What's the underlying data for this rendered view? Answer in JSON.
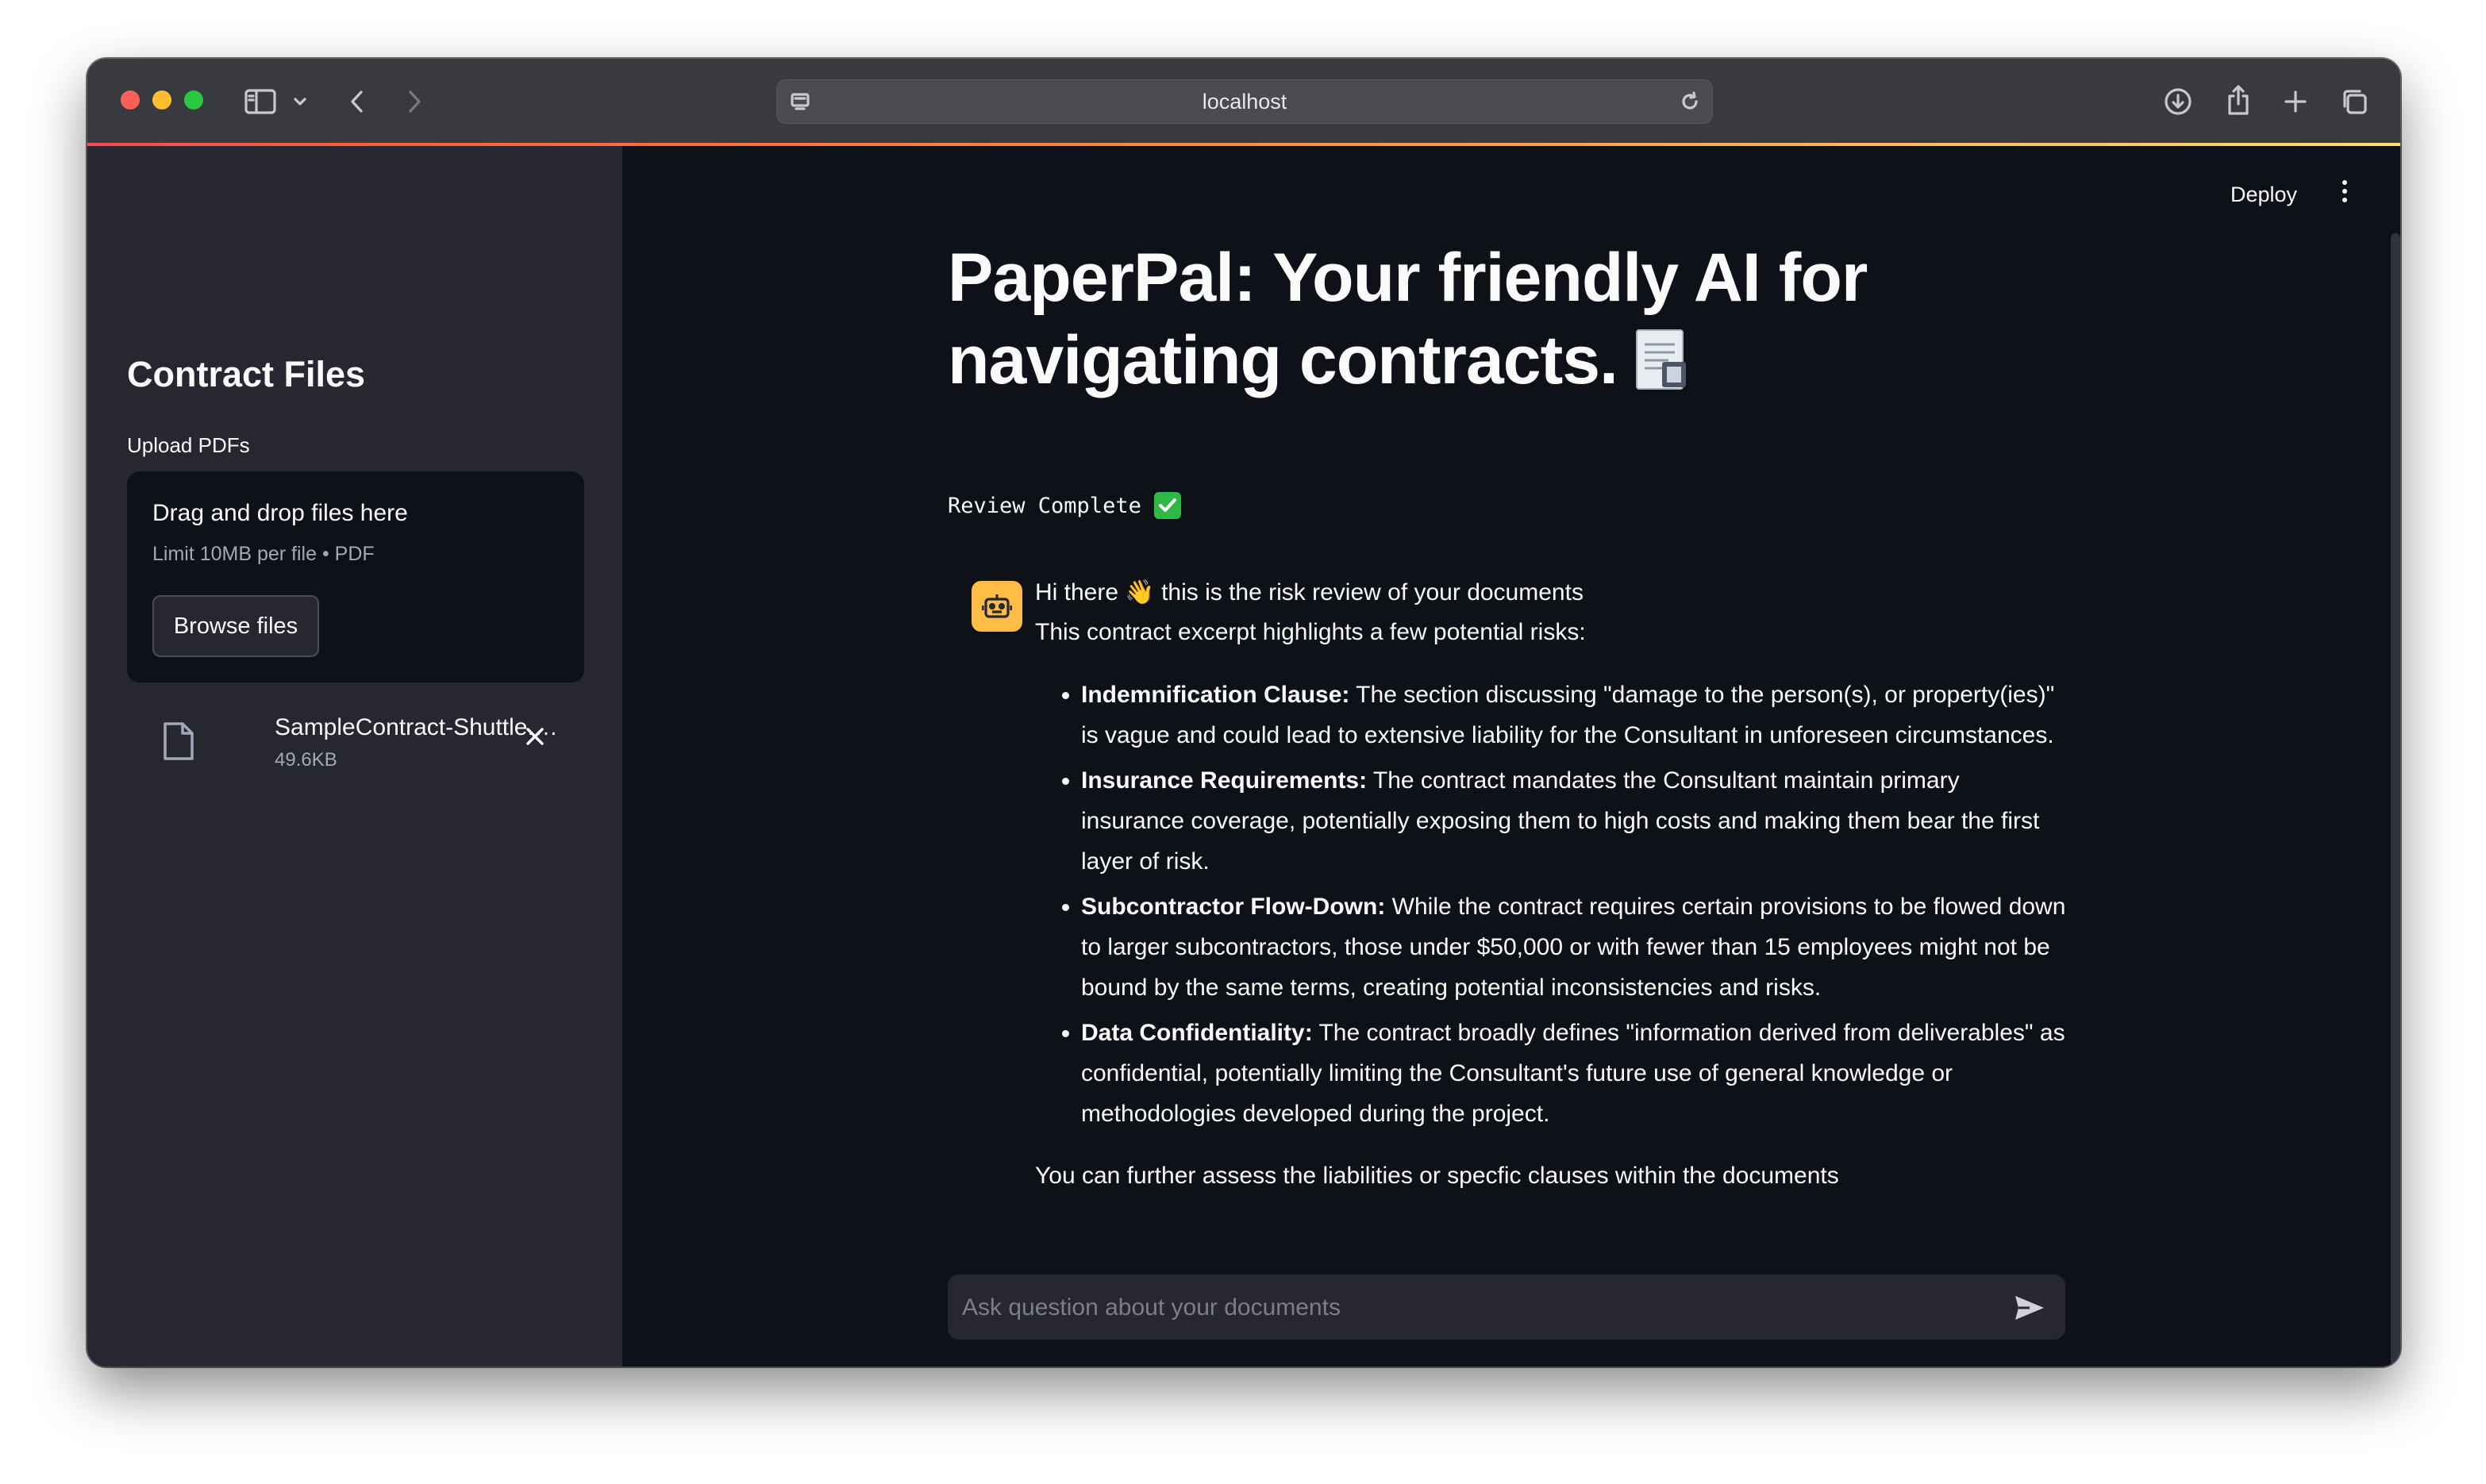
{
  "browser": {
    "url": "localhost"
  },
  "header": {
    "deploy_label": "Deploy"
  },
  "sidebar": {
    "title": "Contract Files",
    "upload_label": "Upload PDFs",
    "dropzone": {
      "title": "Drag and drop files here",
      "subtitle": "Limit 10MB per file • PDF",
      "browse_label": "Browse files"
    },
    "file": {
      "name": "SampleContract-Shuttle.…",
      "size": "49.6KB"
    }
  },
  "main": {
    "title": "PaperPal: Your friendly AI for navigating contracts.",
    "status": "Review Complete",
    "message": {
      "greeting": "Hi there 👋 this is the risk review of your documents",
      "intro": "This contract excerpt highlights a few potential risks:",
      "risks": [
        {
          "label": "Indemnification Clause:",
          "text": " The section discussing \"damage to the person(s), or property(ies)\" is vague and could lead to extensive liability for the Consultant in unforeseen circumstances."
        },
        {
          "label": "Insurance Requirements:",
          "text": " The contract mandates the Consultant maintain primary insurance coverage, potentially exposing them to high costs and making them bear the first layer of risk."
        },
        {
          "label": "Subcontractor Flow-Down:",
          "text": " While the contract requires certain provisions to be flowed down to larger subcontractors, those under $50,000 or with fewer than 15 employees might not be bound by the same terms, creating potential inconsistencies and risks."
        },
        {
          "label": "Data Confidentiality:",
          "text": " The contract broadly defines \"information derived from deliverables\" as confidential, potentially limiting the Consultant's future use of general knowledge or methodologies developed during the project."
        }
      ],
      "footer": "You can further assess the liabilities or specfic clauses within the documents"
    },
    "chat_input": {
      "placeholder": "Ask question about your documents"
    }
  },
  "colors": {
    "sidebar_bg": "#262730",
    "main_bg": "#0e1117",
    "avatar": "#ffbd45",
    "check": "#2fb845"
  },
  "icons": [
    "sidebar-toggle-icon",
    "chevron-down-icon",
    "back-icon",
    "forward-icon",
    "page-icon",
    "reload-icon",
    "download-icon",
    "share-icon",
    "new-tab-icon",
    "tabs-overview-icon",
    "file-icon",
    "close-icon",
    "kebab-menu-icon",
    "bot-icon",
    "check-icon",
    "send-icon",
    "document-emoji-icon"
  ]
}
